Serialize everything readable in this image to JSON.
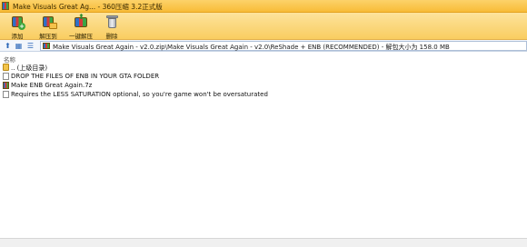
{
  "window": {
    "title": "Make Visuals Great Ag... - 360压缩 3.2正式版"
  },
  "toolbar": {
    "items": [
      {
        "label": "添加",
        "icon": "add-archive-icon"
      },
      {
        "label": "解压到",
        "icon": "extract-to-icon"
      },
      {
        "label": "一键解压",
        "icon": "one-click-extract-icon"
      },
      {
        "label": "删除",
        "icon": "delete-icon"
      }
    ]
  },
  "address": {
    "path": "Make Visuals Great Again - v2.0.zip\\Make Visuals Great Again - v2.0\\ReShade + ENB (RECOMMENDED) - 解包大小为 158.0 MB"
  },
  "columns": {
    "name": "名称"
  },
  "files": [
    {
      "name": ".. (上级目录)",
      "type": "folder"
    },
    {
      "name": "DROP THE FILES OF ENB IN YOUR GTA FOLDER",
      "type": "doc"
    },
    {
      "name": "Make ENB Great Again.7z",
      "type": "archive"
    },
    {
      "name": "Requires the LESS SATURATION optional, so you're game won't be oversaturated",
      "type": "doc"
    }
  ],
  "colors": {
    "toolbar_top": "#fde39c",
    "toolbar_bottom": "#f9cd60",
    "nav_blue": "#2c67b8"
  }
}
